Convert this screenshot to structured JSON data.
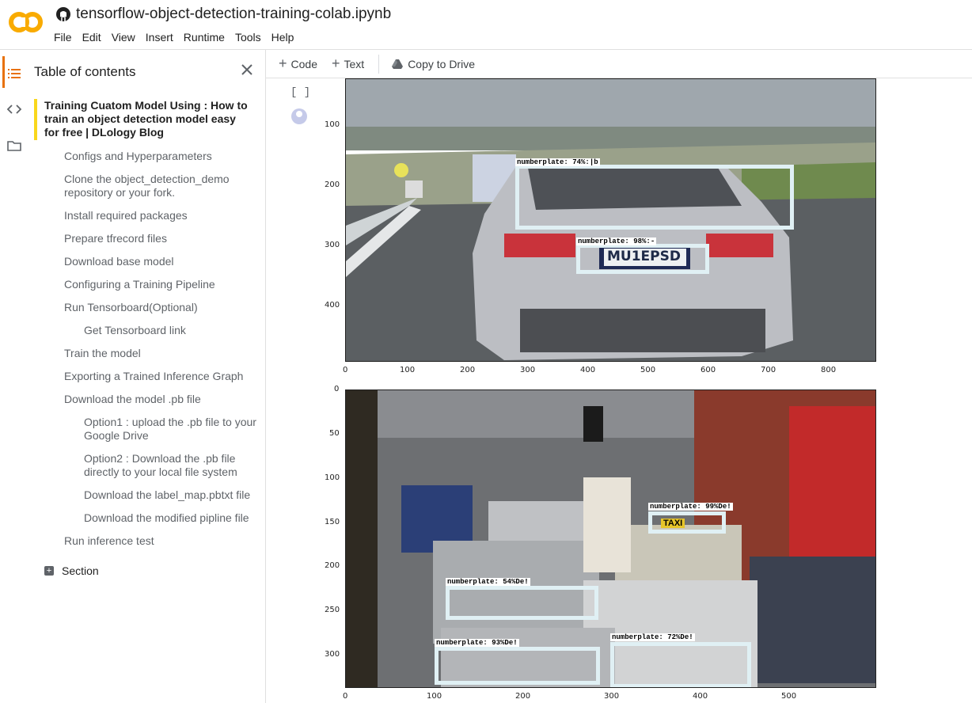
{
  "app": {
    "notebook_title": "tensorflow-object-detection-training-colab.ipynb",
    "menu": [
      "File",
      "Edit",
      "View",
      "Insert",
      "Runtime",
      "Tools",
      "Help"
    ],
    "brand_color": "#f9ab00"
  },
  "toolbar": {
    "code_label": "Code",
    "text_label": "Text",
    "drive_label": "Copy to Drive"
  },
  "toc": {
    "header": "Table of contents",
    "main_heading": "Training Cuatom Model Using : How to train an object detection model easy for free | DLology Blog",
    "items": [
      {
        "label": "Configs and Hyperparameters",
        "level": 2
      },
      {
        "label": "Clone the object_detection_demo repository or your fork.",
        "level": 2
      },
      {
        "label": "Install required packages",
        "level": 2
      },
      {
        "label": "Prepare tfrecord files",
        "level": 2
      },
      {
        "label": "Download base model",
        "level": 2
      },
      {
        "label": "Configuring a Training Pipeline",
        "level": 2
      },
      {
        "label": "Run Tensorboard(Optional)",
        "level": 2
      },
      {
        "label": "Get Tensorboard link",
        "level": 3
      },
      {
        "label": "Train the model",
        "level": 2
      },
      {
        "label": "Exporting a Trained Inference Graph",
        "level": 2
      },
      {
        "label": "Download the model .pb file",
        "level": 2
      },
      {
        "label": "Option1 : upload the .pb file to your Google Drive",
        "level": 3
      },
      {
        "label": "Option2 : Download the .pb file directly to your local file system",
        "level": 3
      },
      {
        "label": "Download the label_map.pbtxt file",
        "level": 3
      },
      {
        "label": "Download the modified pipline file",
        "level": 3
      },
      {
        "label": "Run inference test",
        "level": 2
      }
    ],
    "section_label": "Section"
  },
  "cell": {
    "run_indicator": "[ ]"
  },
  "plot1": {
    "yticks": [
      "100",
      "200",
      "300",
      "400"
    ],
    "xticks": [
      "0",
      "100",
      "200",
      "300",
      "400",
      "500",
      "600",
      "700",
      "800"
    ],
    "labels": [
      "numberplate: 74%:|b",
      "numberplate: 98%:-"
    ]
  },
  "plot2": {
    "yticks": [
      "0",
      "50",
      "100",
      "150",
      "200",
      "250",
      "300"
    ],
    "xticks": [
      "0",
      "100",
      "200",
      "300",
      "400",
      "500"
    ],
    "labels": [
      "numberplate: 99%De!",
      "numberplate: 54%De!",
      "numberplate: 93%De!",
      "numberplate: 72%De!"
    ],
    "plate_text": "MU1EPSD",
    "taxi_text": "TAXI"
  }
}
